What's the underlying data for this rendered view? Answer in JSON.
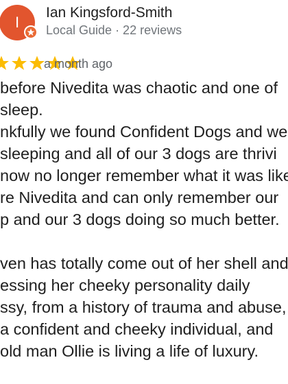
{
  "review": {
    "author": {
      "avatar_initial": "I",
      "name": "Ian Kingsford-Smith",
      "meta": "Local Guide · 22 reviews",
      "avatar_color": "#e2552e"
    },
    "rating": 5,
    "time": "a month ago",
    "star_color": "#fbbc04",
    "paragraphs": [
      [
        "before Nivedita was chaotic and one of",
        "sleep.",
        "nkfully we found Confident Dogs and we",
        "sleeping and all of our 3 dogs are thrivi",
        "now no longer remember what it was like",
        "re Nivedita and can only remember our",
        "p and our 3 dogs doing so much better."
      ],
      [
        "ven has totally come out of her shell and",
        "essing her cheeky personality daily",
        "ssy, from a history of trauma and abuse,",
        "a confident and cheeky individual, and",
        "old man Ollie is living a life of luxury."
      ]
    ]
  }
}
